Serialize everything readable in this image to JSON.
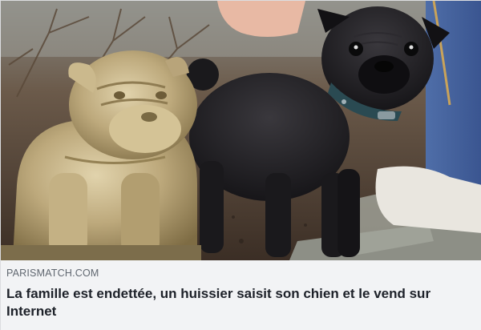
{
  "link_preview": {
    "image": {
      "subjects": [
        "stone-bulldog-statue",
        "black-pug"
      ]
    },
    "source": "PARISMATCH.COM",
    "headline": "La famille est endettée, un huissier saisit son chien et le vend sur Internet"
  },
  "colors": {
    "card_bg": "#f2f3f5",
    "source_text": "#606770",
    "headline_text": "#1d2129",
    "pug_fur": "#1c1b1e",
    "statue_stone": "#b8a47a",
    "collar": "#2a4a52"
  }
}
